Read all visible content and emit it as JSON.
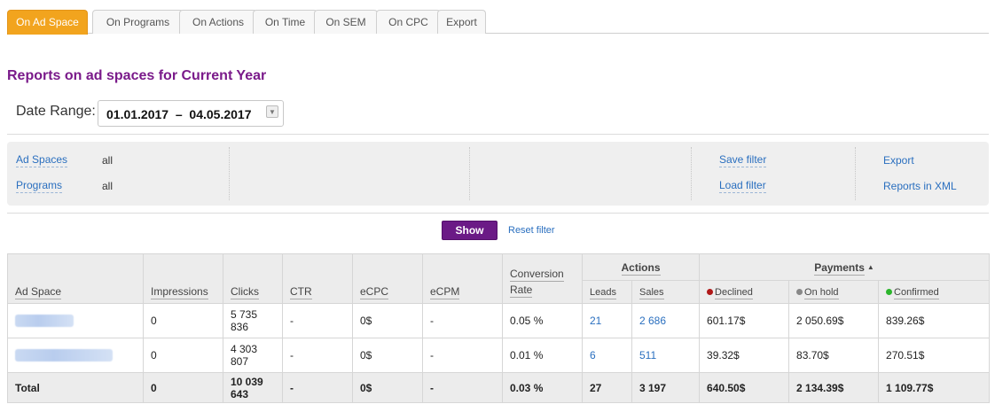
{
  "tabs": [
    {
      "label": "On Ad Space",
      "active": true
    },
    {
      "label": "On Programs"
    },
    {
      "label": "On Actions"
    },
    {
      "label": "On Time"
    },
    {
      "label": "On SEM"
    },
    {
      "label": "On CPC"
    },
    {
      "label": "Export"
    }
  ],
  "title": "Reports on ad spaces for Current Year",
  "date_range": {
    "label": "Date Range:",
    "value": "01.01.2017  –  04.05.2017"
  },
  "filter": {
    "ad_spaces_label": "Ad Spaces",
    "ad_spaces_value": "all",
    "programs_label": "Programs",
    "programs_value": "all",
    "save_filter": "Save filter",
    "load_filter": "Load filter",
    "export": "Export",
    "reports_xml": "Reports in XML"
  },
  "buttons": {
    "show": "Show",
    "reset": "Reset filter"
  },
  "table": {
    "headers": {
      "ad_space": "Ad Space",
      "impressions": "Impressions",
      "clicks": "Clicks",
      "ctr": "CTR",
      "ecpc": "eCPC",
      "ecpm": "eCPM",
      "conversion_rate": "Conversion Rate",
      "actions": "Actions",
      "leads": "Leads",
      "sales": "Sales",
      "payments": "Payments",
      "declined": "Declined",
      "on_hold": "On hold",
      "confirmed": "Confirmed"
    },
    "status_colors": {
      "declined": "#b01818",
      "on_hold": "#888888",
      "confirmed": "#2cb52c"
    },
    "rows": [
      {
        "impressions": "0",
        "clicks": "5 735 836",
        "ctr": "-",
        "ecpc": "0$",
        "ecpm": "-",
        "conv": "0.05 %",
        "leads": "21",
        "sales": "2 686",
        "declined": "601.17$",
        "on_hold": "2 050.69$",
        "confirmed": "839.26$"
      },
      {
        "impressions": "0",
        "clicks": "4 303 807",
        "ctr": "-",
        "ecpc": "0$",
        "ecpm": "-",
        "conv": "0.01 %",
        "leads": "6",
        "sales": "511",
        "declined": "39.32$",
        "on_hold": "83.70$",
        "confirmed": "270.51$"
      }
    ],
    "total": {
      "label": "Total",
      "impressions": "0",
      "clicks": "10 039 643",
      "ctr": "-",
      "ecpc": "0$",
      "ecpm": "-",
      "conv": "0.03 %",
      "leads": "27",
      "sales": "3 197",
      "declined": "640.50$",
      "on_hold": "2 134.39$",
      "confirmed": "1 109.77$"
    }
  }
}
